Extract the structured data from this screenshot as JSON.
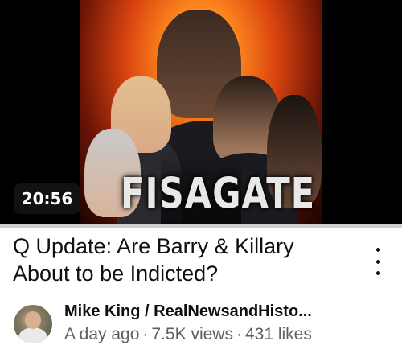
{
  "video": {
    "thumbnail_text": "FISAGATE",
    "duration": "20:56",
    "title": "Q Update: Are Barry & Killary About to be Indicted?",
    "channel": "Mike King / RealNewsandHisto...",
    "age": "A day ago",
    "views": "7.5K views",
    "likes": "431 likes",
    "separator": "·",
    "watched_fraction": 1.0,
    "more_icon": "more-vert-icon"
  },
  "colors": {
    "title_text": "#0f0f0f",
    "meta_text": "#606060",
    "duration_bg": "#141414",
    "thumbnail_fire": "#ff8a1e"
  }
}
